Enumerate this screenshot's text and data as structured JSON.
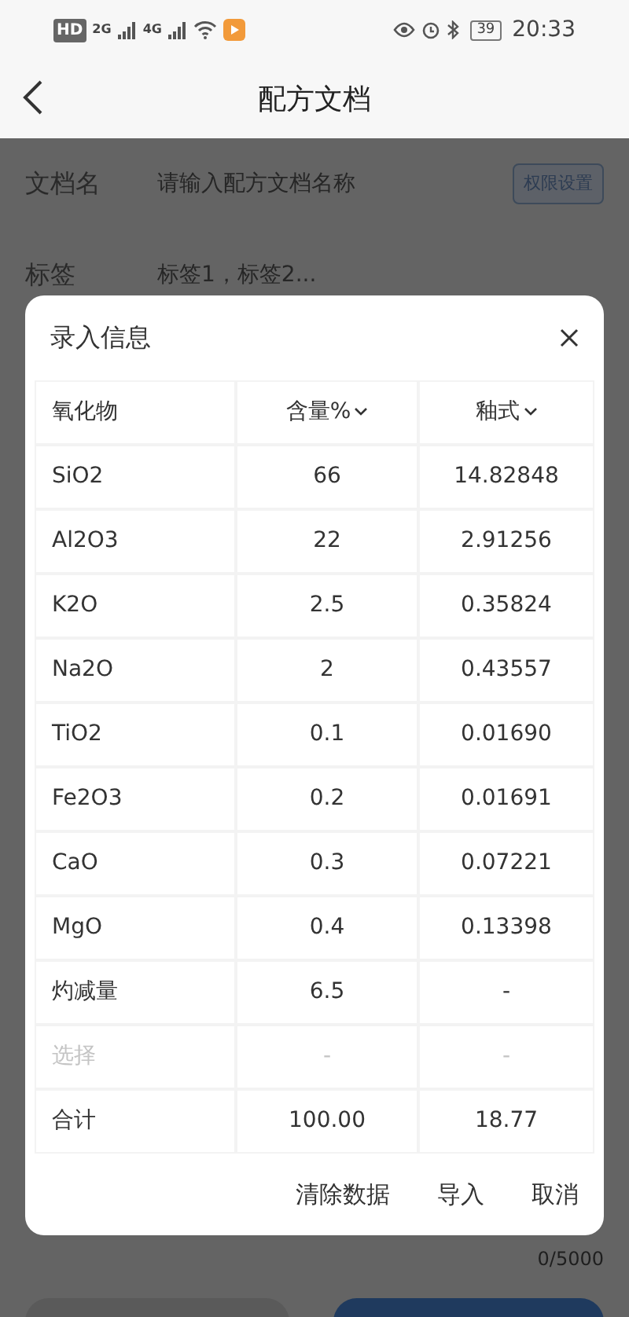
{
  "status_bar": {
    "left": [
      "HD",
      "2G",
      "4G"
    ],
    "battery": "39",
    "time": "20:33"
  },
  "header": {
    "title": "配方文档"
  },
  "form": {
    "fields": [
      {
        "label": "文档名",
        "placeholder": "请输入配方文档名称",
        "button": "权限设置"
      },
      {
        "label": "标签",
        "placeholder": "标签1，标签2..."
      }
    ],
    "counter": "0/5000"
  },
  "dialog": {
    "title": "录入信息",
    "columns": [
      {
        "label": "氧化物",
        "dropdown": false
      },
      {
        "label": "含量%",
        "dropdown": true
      },
      {
        "label": "釉式",
        "dropdown": true
      }
    ],
    "rows": [
      {
        "kind": "oxide",
        "cells": [
          "SiO2",
          "66",
          "14.82848"
        ]
      },
      {
        "kind": "oxide",
        "cells": [
          "Al2O3",
          "22",
          "2.91256"
        ]
      },
      {
        "kind": "oxide",
        "cells": [
          "K2O",
          "2.5",
          "0.35824"
        ]
      },
      {
        "kind": "oxide",
        "cells": [
          "Na2O",
          "2",
          "0.43557"
        ]
      },
      {
        "kind": "oxide",
        "cells": [
          "TiO2",
          "0.1",
          "0.01690"
        ]
      },
      {
        "kind": "oxide",
        "cells": [
          "Fe2O3",
          "0.2",
          "0.01691"
        ]
      },
      {
        "kind": "oxide",
        "cells": [
          "CaO",
          "0.3",
          "0.07221"
        ]
      },
      {
        "kind": "oxide",
        "cells": [
          "MgO",
          "0.4",
          "0.13398"
        ]
      },
      {
        "kind": "oxide",
        "cells": [
          "灼减量",
          "6.5",
          "-"
        ]
      },
      {
        "kind": "select",
        "cells": [
          "选择",
          "-",
          "-"
        ]
      },
      {
        "kind": "total",
        "cells": [
          "合计",
          "100.00",
          "18.77"
        ]
      }
    ],
    "actions": [
      "清除数据",
      "导入",
      "取消"
    ]
  }
}
